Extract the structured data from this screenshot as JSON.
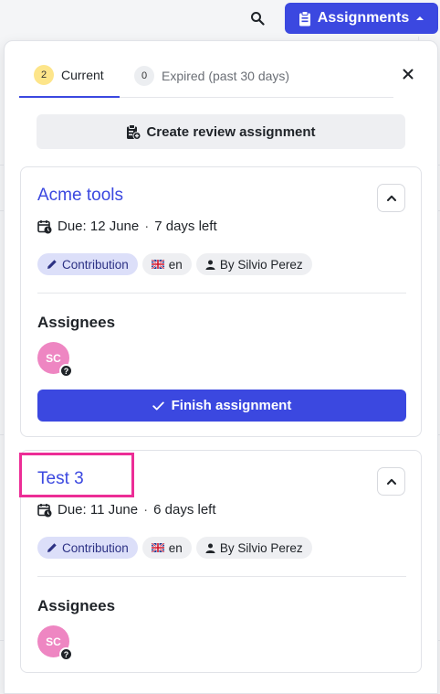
{
  "header": {
    "assignments_label": "Assignments",
    "accent_color": "#3b48e0"
  },
  "tabs": [
    {
      "count": "2",
      "label": "Current"
    },
    {
      "count": "0",
      "label": "Expired (past 30 days)"
    }
  ],
  "create_button": "Create review assignment",
  "cards": [
    {
      "title": "Acme tools",
      "due": "Due: 12 June",
      "left": "7 days left",
      "chips": {
        "type": "Contribution",
        "lang": "en",
        "author": "By Silvio Perez"
      },
      "assignees_label": "Assignees",
      "avatar": "SC",
      "avatar_badge": "?",
      "finish_label": "Finish assignment"
    },
    {
      "title": "Test 3",
      "due": "Due: 11 June",
      "left": "6 days left",
      "chips": {
        "type": "Contribution",
        "lang": "en",
        "author": "By Silvio Perez"
      },
      "assignees_label": "Assignees",
      "avatar": "SC",
      "avatar_badge": "?"
    }
  ],
  "highlight_color": "#ec2d96"
}
